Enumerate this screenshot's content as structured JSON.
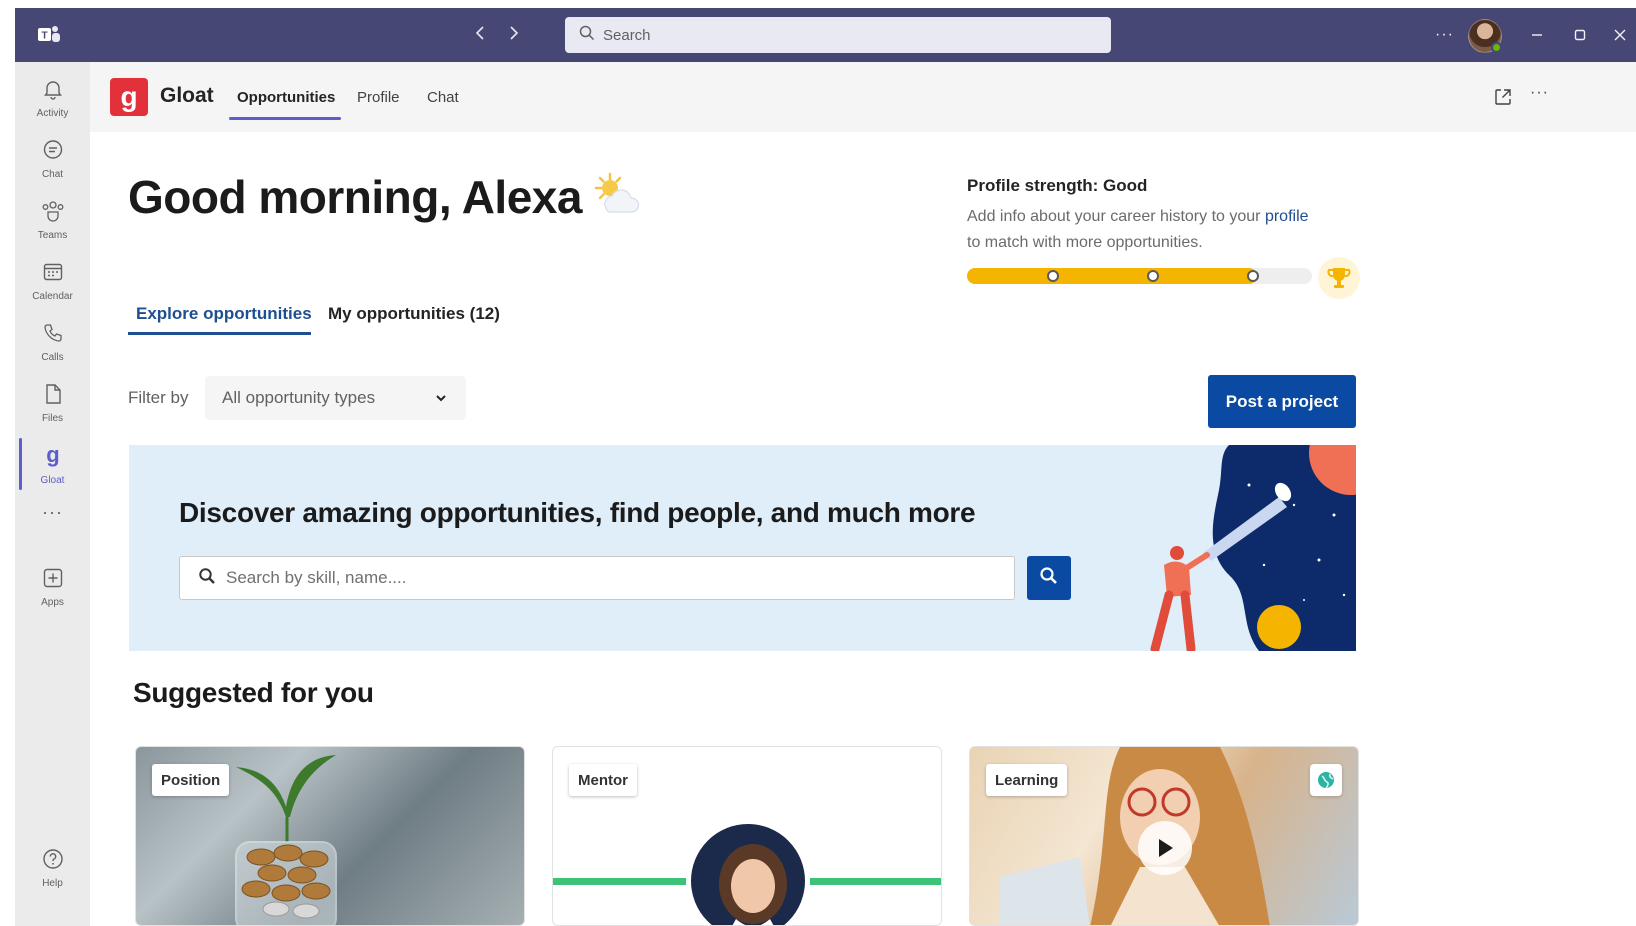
{
  "titlebar": {
    "search_placeholder": "Search",
    "more_label": "···"
  },
  "rail": {
    "items": [
      {
        "label": "Activity",
        "icon": "bell-icon"
      },
      {
        "label": "Chat",
        "icon": "chat-icon"
      },
      {
        "label": "Teams",
        "icon": "teams-icon"
      },
      {
        "label": "Calendar",
        "icon": "calendar-icon"
      },
      {
        "label": "Calls",
        "icon": "phone-icon"
      },
      {
        "label": "Files",
        "icon": "file-icon"
      },
      {
        "label": "Gloat",
        "icon": "gloat-icon"
      },
      {
        "label": "Apps",
        "icon": "plus-box-icon"
      },
      {
        "label": "Help",
        "icon": "help-icon"
      }
    ],
    "active": "Gloat",
    "more_label": "···"
  },
  "app_header": {
    "name": "Gloat",
    "tabs": [
      {
        "label": "Opportunities"
      },
      {
        "label": "Profile"
      },
      {
        "label": "Chat"
      }
    ],
    "active_tab": "Opportunities",
    "more_label": "···"
  },
  "main": {
    "greeting": "Good morning, Alexa",
    "profile_strength": {
      "title": "Profile strength: Good",
      "desc_before": "Add info about your career history to your ",
      "desc_link": "profile",
      "desc_after": "to match with more opportunities.",
      "progress_fraction": 0.84
    },
    "tabs": [
      {
        "label": "Explore opportunities"
      },
      {
        "label": "My opportunities (12)"
      }
    ],
    "filter": {
      "label": "Filter by",
      "selected": "All opportunity types"
    },
    "post_button": "Post a project",
    "banner": {
      "title": "Discover amazing opportunities, find people, and much more",
      "search_placeholder": "Search by skill, name...."
    },
    "suggested_title": "Suggested for you",
    "cards": [
      {
        "tag": "Position"
      },
      {
        "tag": "Mentor"
      },
      {
        "tag": "Learning"
      }
    ]
  },
  "colors": {
    "titlebar": "#464775",
    "accent": "#0b4aa2",
    "brand": "#e3313b",
    "progress": "#f5b400"
  }
}
